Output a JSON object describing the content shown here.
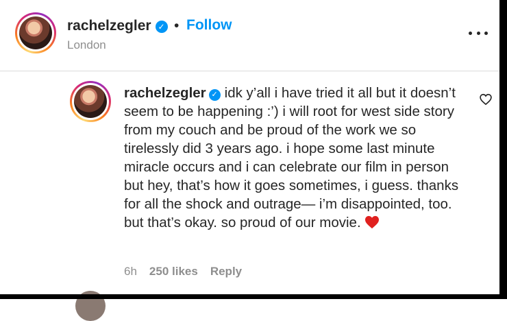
{
  "header": {
    "username": "rachelzegler",
    "separator": "•",
    "follow_label": "Follow",
    "location": "London"
  },
  "comment": {
    "username": "rachelzegler",
    "text": "idk y’all i have tried it all but it doesn’t seem to be happening :’) i will root for west side story from my couch and be proud of the work we so tirelessly did 3 years ago. i hope some last minute miracle occurs and i can celebrate our film in person but hey, that’s how it goes sometimes, i guess. thanks for all the shock and outrage— i’m disappointed, too. but that’s okay. so proud of our movie.",
    "emoji": "❤️",
    "time": "6h",
    "likes": "250 likes",
    "reply_label": "Reply"
  },
  "icons": {
    "verified": "verified-badge-icon",
    "more": "more-options-icon",
    "like": "heart-outline-icon"
  },
  "colors": {
    "accent": "#0095f6",
    "text": "#262626",
    "muted": "#8e8e8e",
    "heart": "#e0211f"
  }
}
